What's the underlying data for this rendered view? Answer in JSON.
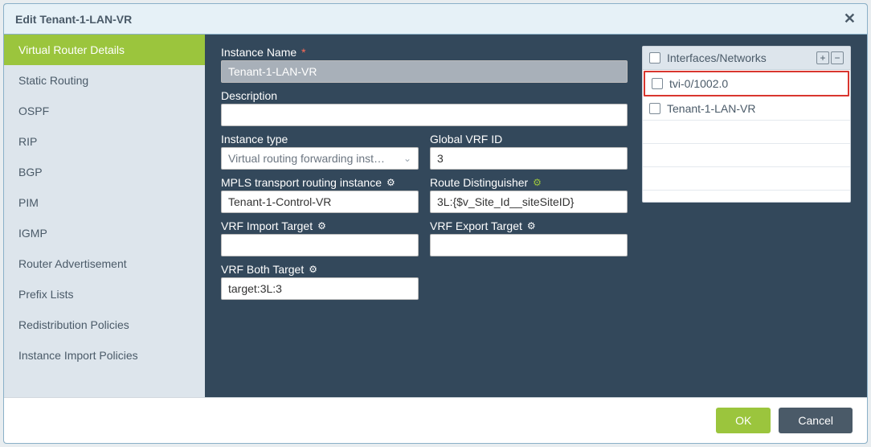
{
  "titlebar": {
    "title": "Edit Tenant-1-LAN-VR",
    "close": "✕"
  },
  "sidebar": {
    "items": [
      {
        "label": "Virtual Router Details",
        "active": true
      },
      {
        "label": "Static Routing"
      },
      {
        "label": "OSPF"
      },
      {
        "label": "RIP"
      },
      {
        "label": "BGP"
      },
      {
        "label": "PIM"
      },
      {
        "label": "IGMP"
      },
      {
        "label": "Router Advertisement"
      },
      {
        "label": "Prefix Lists"
      },
      {
        "label": "Redistribution Policies"
      },
      {
        "label": "Instance Import Policies"
      }
    ]
  },
  "form": {
    "instanceName": {
      "label": "Instance Name",
      "value": "Tenant-1-LAN-VR"
    },
    "description": {
      "label": "Description",
      "value": ""
    },
    "instanceType": {
      "label": "Instance type",
      "value": "Virtual routing forwarding inst…"
    },
    "globalVrfId": {
      "label": "Global VRF ID",
      "value": "3"
    },
    "mplsTransport": {
      "label": "MPLS transport routing instance",
      "value": "Tenant-1-Control-VR"
    },
    "routeDistinguisher": {
      "label": "Route Distinguisher",
      "value": "3L:{$v_Site_Id__siteSiteID}"
    },
    "vrfImport": {
      "label": "VRF Import Target",
      "value": ""
    },
    "vrfExport": {
      "label": "VRF Export Target",
      "value": ""
    },
    "vrfBoth": {
      "label": "VRF Both Target",
      "value": "target:3L:3"
    }
  },
  "interfacesPanel": {
    "header": "Interfaces/Networks",
    "addIcon": "+",
    "removeIcon": "−",
    "rows": [
      {
        "label": "tvi-0/1002.0",
        "highlighted": true
      },
      {
        "label": "Tenant-1-LAN-VR"
      }
    ]
  },
  "footer": {
    "ok": "OK",
    "cancel": "Cancel"
  },
  "icons": {
    "gear": "⚙",
    "chevronDown": "⌄"
  }
}
